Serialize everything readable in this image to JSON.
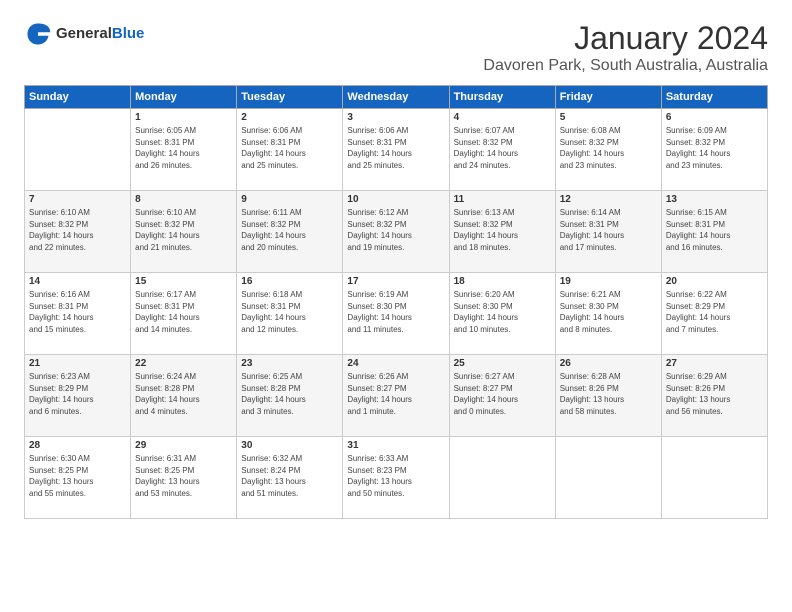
{
  "header": {
    "logo_general": "General",
    "logo_blue": "Blue",
    "month": "January 2024",
    "location": "Davoren Park, South Australia, Australia"
  },
  "days_of_week": [
    "Sunday",
    "Monday",
    "Tuesday",
    "Wednesday",
    "Thursday",
    "Friday",
    "Saturday"
  ],
  "weeks": [
    [
      {
        "day": "",
        "info": ""
      },
      {
        "day": "1",
        "info": "Sunrise: 6:05 AM\nSunset: 8:31 PM\nDaylight: 14 hours\nand 26 minutes."
      },
      {
        "day": "2",
        "info": "Sunrise: 6:06 AM\nSunset: 8:31 PM\nDaylight: 14 hours\nand 25 minutes."
      },
      {
        "day": "3",
        "info": "Sunrise: 6:06 AM\nSunset: 8:31 PM\nDaylight: 14 hours\nand 25 minutes."
      },
      {
        "day": "4",
        "info": "Sunrise: 6:07 AM\nSunset: 8:32 PM\nDaylight: 14 hours\nand 24 minutes."
      },
      {
        "day": "5",
        "info": "Sunrise: 6:08 AM\nSunset: 8:32 PM\nDaylight: 14 hours\nand 23 minutes."
      },
      {
        "day": "6",
        "info": "Sunrise: 6:09 AM\nSunset: 8:32 PM\nDaylight: 14 hours\nand 23 minutes."
      }
    ],
    [
      {
        "day": "7",
        "info": "Sunrise: 6:10 AM\nSunset: 8:32 PM\nDaylight: 14 hours\nand 22 minutes."
      },
      {
        "day": "8",
        "info": "Sunrise: 6:10 AM\nSunset: 8:32 PM\nDaylight: 14 hours\nand 21 minutes."
      },
      {
        "day": "9",
        "info": "Sunrise: 6:11 AM\nSunset: 8:32 PM\nDaylight: 14 hours\nand 20 minutes."
      },
      {
        "day": "10",
        "info": "Sunrise: 6:12 AM\nSunset: 8:32 PM\nDaylight: 14 hours\nand 19 minutes."
      },
      {
        "day": "11",
        "info": "Sunrise: 6:13 AM\nSunset: 8:32 PM\nDaylight: 14 hours\nand 18 minutes."
      },
      {
        "day": "12",
        "info": "Sunrise: 6:14 AM\nSunset: 8:31 PM\nDaylight: 14 hours\nand 17 minutes."
      },
      {
        "day": "13",
        "info": "Sunrise: 6:15 AM\nSunset: 8:31 PM\nDaylight: 14 hours\nand 16 minutes."
      }
    ],
    [
      {
        "day": "14",
        "info": "Sunrise: 6:16 AM\nSunset: 8:31 PM\nDaylight: 14 hours\nand 15 minutes."
      },
      {
        "day": "15",
        "info": "Sunrise: 6:17 AM\nSunset: 8:31 PM\nDaylight: 14 hours\nand 14 minutes."
      },
      {
        "day": "16",
        "info": "Sunrise: 6:18 AM\nSunset: 8:31 PM\nDaylight: 14 hours\nand 12 minutes."
      },
      {
        "day": "17",
        "info": "Sunrise: 6:19 AM\nSunset: 8:30 PM\nDaylight: 14 hours\nand 11 minutes."
      },
      {
        "day": "18",
        "info": "Sunrise: 6:20 AM\nSunset: 8:30 PM\nDaylight: 14 hours\nand 10 minutes."
      },
      {
        "day": "19",
        "info": "Sunrise: 6:21 AM\nSunset: 8:30 PM\nDaylight: 14 hours\nand 8 minutes."
      },
      {
        "day": "20",
        "info": "Sunrise: 6:22 AM\nSunset: 8:29 PM\nDaylight: 14 hours\nand 7 minutes."
      }
    ],
    [
      {
        "day": "21",
        "info": "Sunrise: 6:23 AM\nSunset: 8:29 PM\nDaylight: 14 hours\nand 6 minutes."
      },
      {
        "day": "22",
        "info": "Sunrise: 6:24 AM\nSunset: 8:28 PM\nDaylight: 14 hours\nand 4 minutes."
      },
      {
        "day": "23",
        "info": "Sunrise: 6:25 AM\nSunset: 8:28 PM\nDaylight: 14 hours\nand 3 minutes."
      },
      {
        "day": "24",
        "info": "Sunrise: 6:26 AM\nSunset: 8:27 PM\nDaylight: 14 hours\nand 1 minute."
      },
      {
        "day": "25",
        "info": "Sunrise: 6:27 AM\nSunset: 8:27 PM\nDaylight: 14 hours\nand 0 minutes."
      },
      {
        "day": "26",
        "info": "Sunrise: 6:28 AM\nSunset: 8:26 PM\nDaylight: 13 hours\nand 58 minutes."
      },
      {
        "day": "27",
        "info": "Sunrise: 6:29 AM\nSunset: 8:26 PM\nDaylight: 13 hours\nand 56 minutes."
      }
    ],
    [
      {
        "day": "28",
        "info": "Sunrise: 6:30 AM\nSunset: 8:25 PM\nDaylight: 13 hours\nand 55 minutes."
      },
      {
        "day": "29",
        "info": "Sunrise: 6:31 AM\nSunset: 8:25 PM\nDaylight: 13 hours\nand 53 minutes."
      },
      {
        "day": "30",
        "info": "Sunrise: 6:32 AM\nSunset: 8:24 PM\nDaylight: 13 hours\nand 51 minutes."
      },
      {
        "day": "31",
        "info": "Sunrise: 6:33 AM\nSunset: 8:23 PM\nDaylight: 13 hours\nand 50 minutes."
      },
      {
        "day": "",
        "info": ""
      },
      {
        "day": "",
        "info": ""
      },
      {
        "day": "",
        "info": ""
      }
    ]
  ]
}
